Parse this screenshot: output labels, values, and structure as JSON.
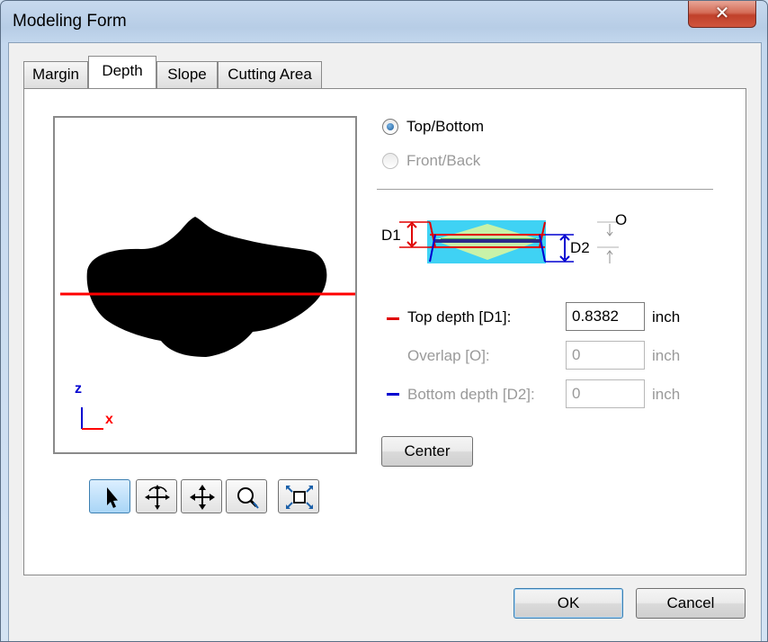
{
  "window": {
    "title": "Modeling Form",
    "close_glyph": "✕"
  },
  "tabs": [
    {
      "label": "Margin",
      "active": false
    },
    {
      "label": "Depth",
      "active": true
    },
    {
      "label": "Slope",
      "active": false
    },
    {
      "label": "Cutting Area",
      "active": false
    }
  ],
  "preview": {
    "axis_z_label": "z",
    "axis_x_label": "x",
    "cut_line_color": "#ff0000"
  },
  "toolbar": {
    "buttons": [
      {
        "icon": "select-arrow-icon",
        "active": true
      },
      {
        "icon": "rotate-icon",
        "active": false
      },
      {
        "icon": "pan-icon",
        "active": false
      },
      {
        "icon": "zoom-icon",
        "active": false
      },
      {
        "icon": "fit-view-icon",
        "active": false
      }
    ]
  },
  "orientation": {
    "options": [
      {
        "label": "Top/Bottom",
        "checked": true,
        "enabled": true
      },
      {
        "label": "Front/Back",
        "checked": false,
        "enabled": false
      }
    ]
  },
  "diagram": {
    "d1_label": "D1",
    "d2_label": "D2",
    "overlap_label": "O"
  },
  "fields": {
    "top_depth": {
      "label": "Top depth [D1]:",
      "value": "0.8382",
      "unit": "inch",
      "color": "#e00000",
      "enabled": true
    },
    "overlap": {
      "label": "Overlap [O]:",
      "value": "0",
      "unit": "inch",
      "enabled": false
    },
    "bottom_depth": {
      "label": "Bottom depth [D2]:",
      "value": "0",
      "unit": "inch",
      "color": "#0000d0",
      "enabled": false
    }
  },
  "center_button": {
    "label": "Center"
  },
  "footer": {
    "ok_label": "OK",
    "cancel_label": "Cancel"
  }
}
